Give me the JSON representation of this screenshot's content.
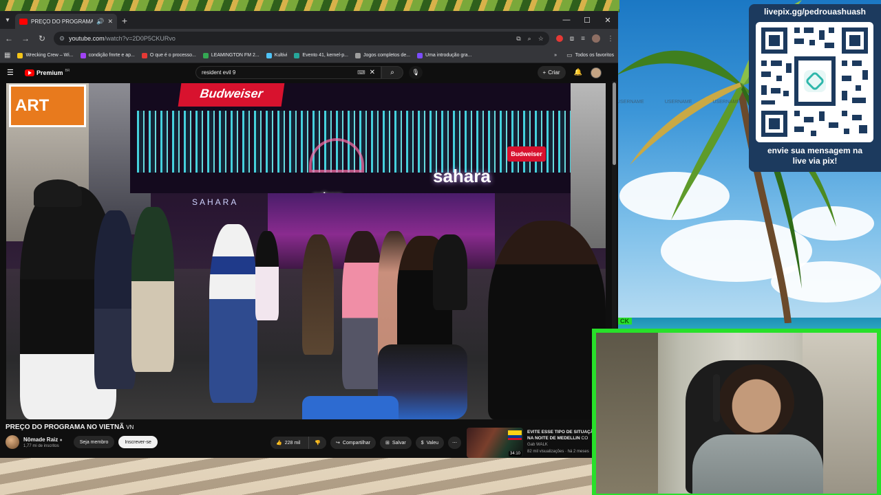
{
  "browser": {
    "tab_title": "PREÇO DO PROGRAMA NO VIETNÃ",
    "url_host": "youtube.com",
    "url_path": "/watch?v=2D0P5CKURvo",
    "bookmarks": [
      {
        "label": "Wrecking Crew – Wi...",
        "color": "#f5c518"
      },
      {
        "label": "condição fmrte e ap...",
        "color": "#a142f4"
      },
      {
        "label": "O que é o processo...",
        "color": "#e53935"
      },
      {
        "label": "LEAMINGTON FM 2...",
        "color": "#34a853"
      },
      {
        "label": "Kultivi",
        "color": "#4fc3f7"
      },
      {
        "label": "Evento 41, kernel-p...",
        "color": "#26a69a"
      },
      {
        "label": "Jogos completos de...",
        "color": "#9e9e9e"
      },
      {
        "label": "Uma introdução gra...",
        "color": "#7c4dff"
      }
    ],
    "bookmarks_more": "»",
    "favorites_label": "Todos os favoritos"
  },
  "youtube": {
    "logo_text": "Premium",
    "logo_suffix": "BR",
    "search_query": "resident evil 9",
    "create_label": "Criar",
    "video_title": "PREÇO DO PROGRAMA NO VIETNÃ",
    "video_title_suffix": "VN",
    "channel_name": "Nômade Raiz",
    "channel_subs": "1,77 mi de inscritos",
    "member_label": "Seja membro",
    "subscribe_label": "Inscrever-se",
    "likes": "228 mil",
    "share_label": "Compartilhar",
    "save_label": "Salvar",
    "thanks_label": "Valeu",
    "recommended": {
      "title": "EVITE ESSE TIPO DE SITUAÇÃO NA NOITE DE MEDELLIN",
      "title_suffix": "CO",
      "channel": "Gab WALK",
      "views": "82 mil visualizações · há 2 meses",
      "duration": "34:10"
    },
    "video_signs": [
      "Budweiser",
      "sahara",
      "sahara",
      "Budweiser",
      "SAHARA",
      "ART"
    ]
  },
  "livepix": {
    "url": "livepix.gg/pedrouashuash",
    "message_line1": "envie sua mensagem na",
    "message_line2": "live via pix!"
  },
  "overlay": {
    "ghost_labels": [
      "USERNAME",
      "USERNAME",
      "USERNAME"
    ],
    "ghost_tag": "CK"
  }
}
